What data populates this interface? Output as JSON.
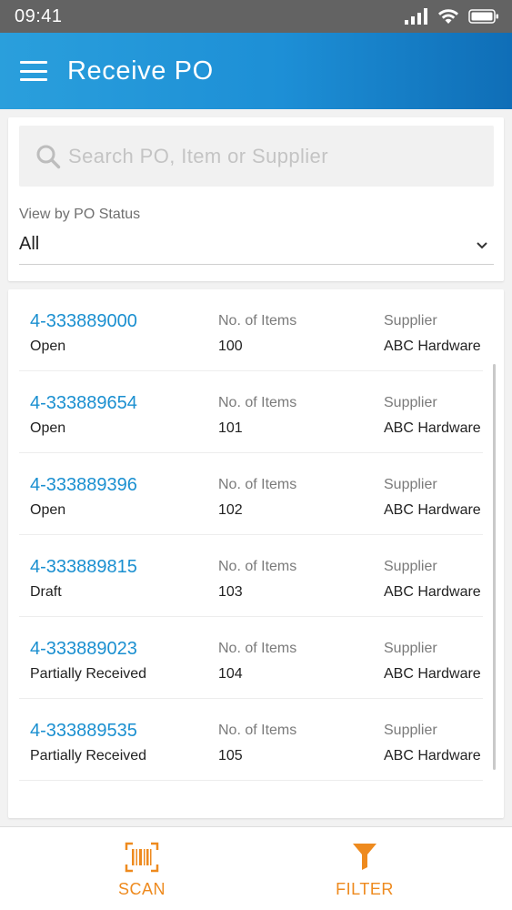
{
  "status_bar": {
    "time": "09:41"
  },
  "app_bar": {
    "title": "Receive PO"
  },
  "search": {
    "placeholder": "Search PO, Item or Supplier"
  },
  "status_filter": {
    "label": "View by PO Status",
    "value": "All"
  },
  "purchase_orders": [
    {
      "number": "4-333889000",
      "status": "Open",
      "items_label": "No. of Items",
      "items": "100",
      "supplier_label": "Supplier",
      "supplier": "ABC Hardware"
    },
    {
      "number": "4-333889654",
      "status": "Open",
      "items_label": "No. of Items",
      "items": "101",
      "supplier_label": "Supplier",
      "supplier": "ABC Hardware"
    },
    {
      "number": "4-333889396",
      "status": "Open",
      "items_label": "No. of Items",
      "items": "102",
      "supplier_label": "Supplier",
      "supplier": "ABC Hardware"
    },
    {
      "number": "4-333889815",
      "status": "Draft",
      "items_label": "No. of Items",
      "items": "103",
      "supplier_label": "Supplier",
      "supplier": "ABC Hardware"
    },
    {
      "number": "4-333889023",
      "status": "Partially Received",
      "items_label": "No. of Items",
      "items": "104",
      "supplier_label": "Supplier",
      "supplier": "ABC Hardware"
    },
    {
      "number": "4-333889535",
      "status": "Partially Received",
      "items_label": "No. of Items",
      "items": "105",
      "supplier_label": "Supplier",
      "supplier": "ABC Hardware"
    }
  ],
  "bottom_nav": [
    {
      "label": "SCAN",
      "icon": "barcode-scan-icon"
    },
    {
      "label": "FILTER",
      "icon": "funnel-filter-icon"
    }
  ],
  "colors": {
    "app_bar_start": "#2a9fdc",
    "app_bar_end": "#0f6eb7",
    "po_link": "#1a8fd0",
    "accent_orange": "#ee8a1e",
    "status_bar": "#636363"
  }
}
